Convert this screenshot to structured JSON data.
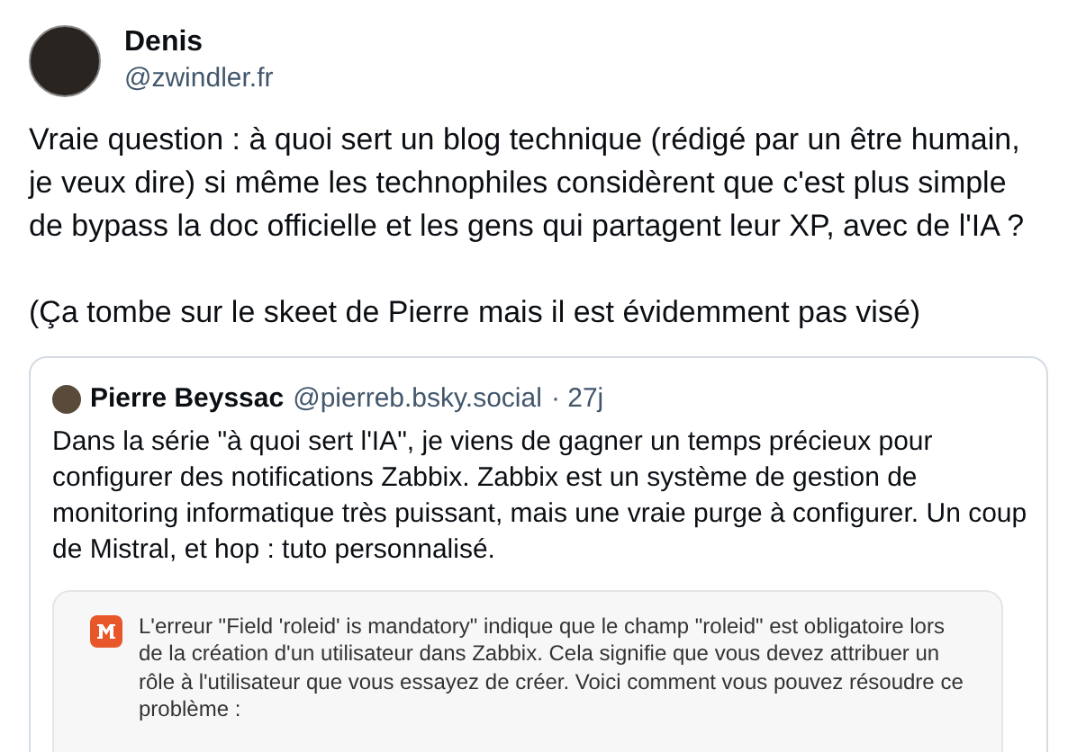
{
  "post": {
    "author": {
      "name": "Denis",
      "handle": "@zwindler.fr"
    },
    "paragraphs": [
      "Vraie question : à quoi sert un blog technique (rédigé par un être humain, je veux dire) si même les technophiles considèrent que c'est plus simple de bypass la doc officielle et les gens qui partagent leur XP, avec de l'IA ?",
      "(Ça tombe sur le skeet de Pierre mais il est évidemment pas visé)"
    ],
    "quote": {
      "author": {
        "name": "Pierre Beyssac",
        "handle": "@pierreb.bsky.social",
        "time": "· 27j"
      },
      "text": "Dans la série \"à quoi sert l'IA\", je viens de gagner un temps précieux pour configurer des notifications Zabbix. Zabbix est un système de gestion de monitoring informatique très puissant, mais une vraie purge à configurer. Un coup de Mistral, et hop : tuto personnalisé.",
      "screenshot": {
        "message": "L'erreur \"Field 'roleid' is mandatory\" indique que le champ \"roleid\" est obligatoire lors de la création d'un utilisateur dans Zabbix. Cela signifie que vous devez attribuer un rôle à l'utilisateur que vous essayez de créer. Voici comment vous pouvez résoudre ce problème :"
      }
    }
  }
}
